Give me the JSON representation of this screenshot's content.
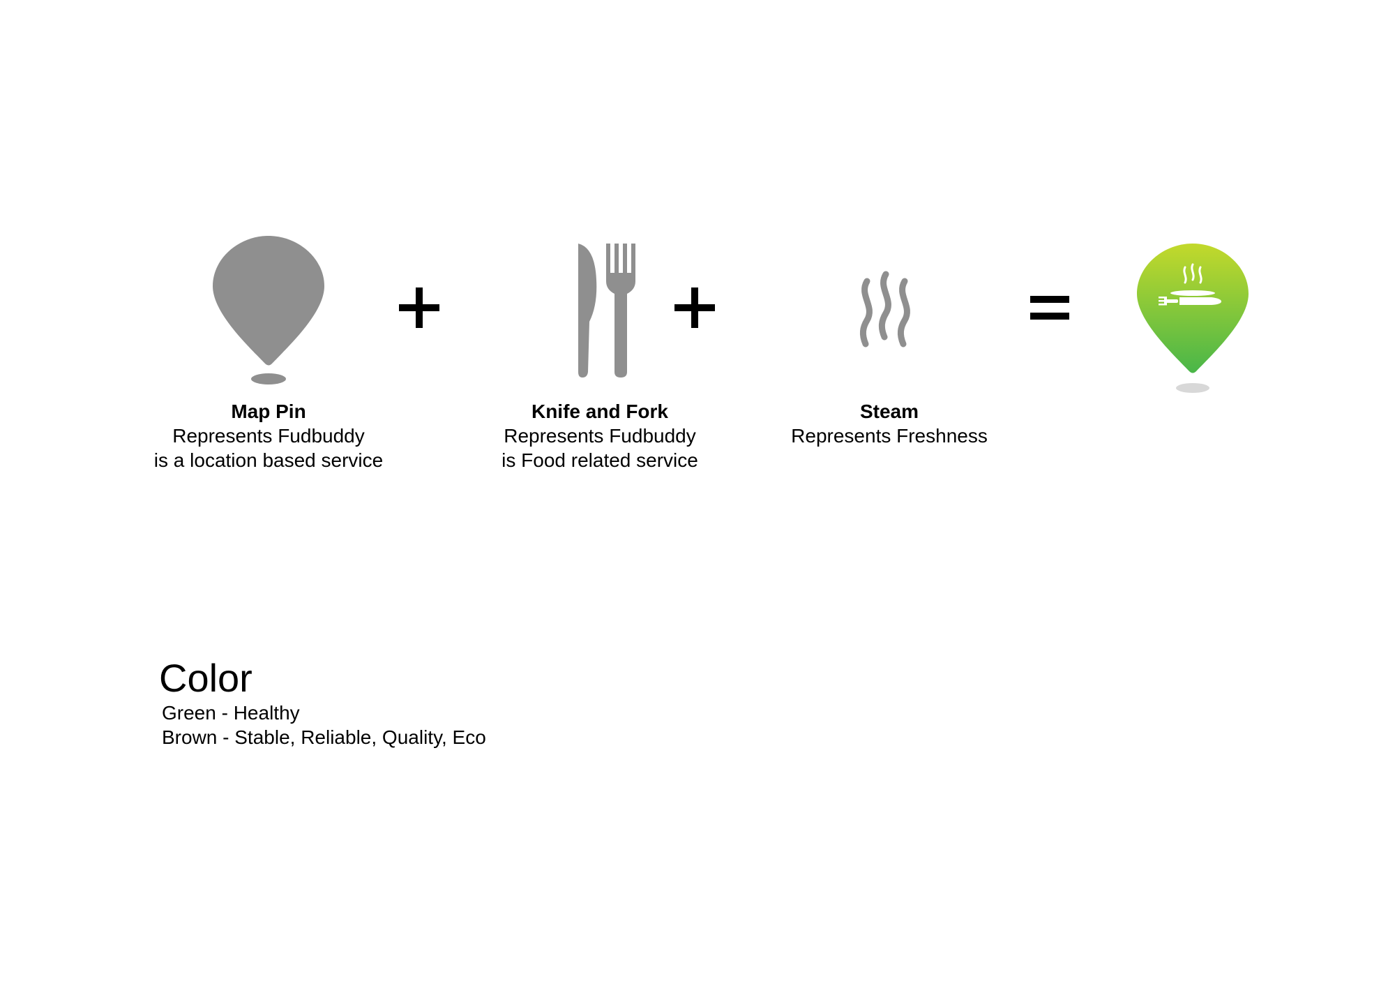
{
  "components": [
    {
      "key": "map_pin",
      "icon": "map-pin-icon",
      "title": "Map Pin",
      "lines": [
        "Represents Fudbuddy",
        "is a location based service"
      ]
    },
    {
      "key": "knife_fork",
      "icon": "knife-and-fork-icon",
      "title": "Knife and Fork",
      "lines": [
        "Represents Fudbuddy",
        "is Food related service"
      ]
    },
    {
      "key": "steam",
      "icon": "steam-icon",
      "title": "Steam",
      "lines": [
        "Represents Freshness"
      ]
    }
  ],
  "operators": [
    "+",
    "+",
    "="
  ],
  "result": {
    "icon": "fudbuddy-logo-icon"
  },
  "colors": {
    "symbol_gray": "#8f8f8f",
    "logo_green_top": "#c3d92b",
    "logo_green_bottom": "#49b649"
  },
  "color_section": {
    "heading": "Color",
    "lines": [
      "Green - Healthy",
      "Brown - Stable, Reliable, Quality, Eco"
    ]
  }
}
